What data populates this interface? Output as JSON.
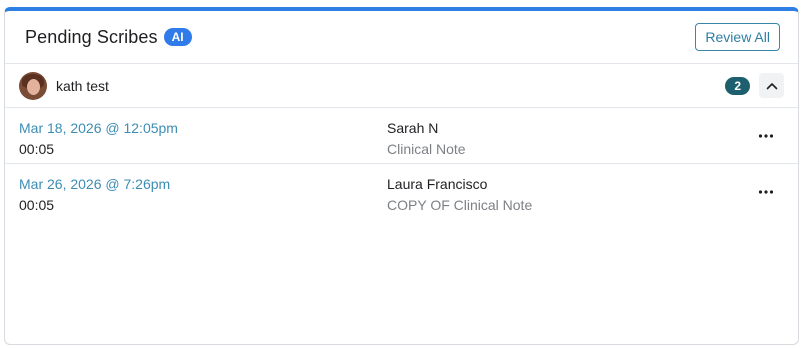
{
  "header": {
    "title": "Pending Scribes",
    "ai_badge": "AI",
    "review_all_label": "Review All"
  },
  "group": {
    "user_name": "kath test",
    "count": "2",
    "expanded": true
  },
  "scribes": [
    {
      "date": "Mar 18, 2026 @ 12:05pm",
      "duration": "00:05",
      "author": "Sarah N",
      "note_type": "Clinical Note"
    },
    {
      "date": "Mar 26, 2026 @ 7:26pm",
      "duration": "00:05",
      "author": "Laura Francisco",
      "note_type": "COPY OF Clinical Note"
    }
  ],
  "colors": {
    "accent_top_border": "#2d7fe3",
    "ai_badge": "#2f7bea",
    "count_badge": "#1d5f6e",
    "date_link": "#3d8db3"
  },
  "icons": {
    "collapse": "chevron-up-icon",
    "row_menu": "more-horizontal-icon"
  }
}
